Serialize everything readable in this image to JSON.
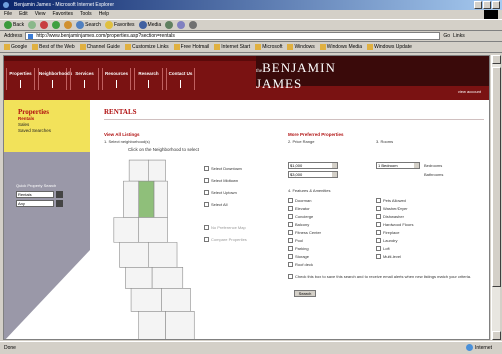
{
  "window": {
    "title": "Benjamin James - Microsoft Internet Explorer"
  },
  "menubar": [
    "File",
    "Edit",
    "View",
    "Favorites",
    "Tools",
    "Help"
  ],
  "toolbar": {
    "back": "Back",
    "search": "Search",
    "favorites": "Favorites",
    "media": "Media"
  },
  "address": {
    "label": "Address",
    "url": "http://www.benjaminjames.com/properties.asp?section=rentals",
    "go": "Go",
    "links": "Links"
  },
  "links": [
    "Google",
    "Best of the Web",
    "Channel Guide",
    "Customize Links",
    "Free Hotmail",
    "Internet Start",
    "Microsoft",
    "Windows",
    "Windows Media",
    "Windows Update"
  ],
  "site": {
    "nav": [
      "Properties",
      "Neighborhoods",
      "Services",
      "Resources",
      "Research",
      "Contact Us"
    ],
    "logo_line1": "BENJAMIN",
    "logo_line2": "JAMES",
    "logo_prefix": "the",
    "top_link": "view account"
  },
  "sidebar": {
    "heading": "Properties",
    "items": [
      "Rentals",
      "Sales",
      "Saved Searches"
    ],
    "search_label": "Quick Property Search",
    "search_value1": "Rentals",
    "search_value2": "Any"
  },
  "page_title": "RENTALS",
  "left": {
    "view_all": "View All Listings",
    "select_label": "1. Select neighborhood(s)",
    "map_caption": "Click on the Neighborhood to select",
    "neighborhoods": [
      "Select Downtown",
      "Select Midtown",
      "Select Uptown",
      "Select All"
    ],
    "greyed": [
      "No Preference Map",
      "Compare Properties"
    ]
  },
  "right": {
    "heading": "More Preferred Properties",
    "rent_label": "2. Price Range",
    "rent_from": "$1,000",
    "rent_to": "$3,000",
    "rooms_label": "3. Rooms",
    "rooms_value": "1 Bedroom",
    "beds_unit": "Bedrooms",
    "baths_unit": "Bathrooms",
    "amenities_label": "4. Features & Amenities",
    "amenities_left": [
      "Doorman",
      "Elevator",
      "Concierge",
      "Balcony",
      "Fitness Center",
      "Pool",
      "Parking",
      "Storage",
      "Roof deck"
    ],
    "amenities_right": [
      "Pets Allowed",
      "Washer/Dryer",
      "Dishwasher",
      "Hardwood Floors",
      "Fireplace",
      "Laundry",
      "Loft",
      "Multi-level"
    ],
    "notice": "Check this box to save this search and to receive email alerts when new listings match your criteria.",
    "submit": "Search"
  },
  "status": {
    "text": "Done",
    "zone": "Internet"
  }
}
